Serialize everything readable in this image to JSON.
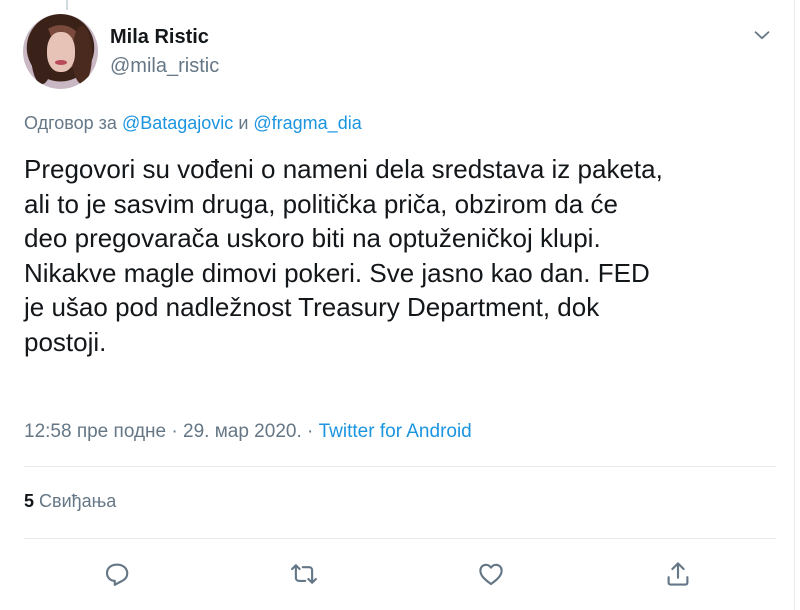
{
  "author": {
    "name": "Mila Ristic",
    "handle": "@mila_ristic"
  },
  "reply_context": {
    "prefix": "Одговор за",
    "mention1": "@Batagajovic",
    "conjunction": "и",
    "mention2": "@fragma_dia"
  },
  "tweet": {
    "text": "Pregovori su vođeni o nameni dela sredstava iz paketa,\nali to je sasvim druga, politička priča, obzirom da će\ndeo pregovarača uskoro biti na optuženičkoj klupi.\nNikakve magle dimovi pokeri. Sve jasno kao dan. FED\nje ušao pod nadležnost Treasury Department, dok\npostoji."
  },
  "meta": {
    "time": "12:58 пре подне",
    "date": "29. мар 2020.",
    "separator": "·",
    "source": "Twitter for Android"
  },
  "stats": {
    "likes_count": "5",
    "likes_label": "Свиђања"
  },
  "icons": {
    "menu": "chevron-down-icon",
    "reply": "reply-icon",
    "retweet": "retweet-icon",
    "like": "heart-icon",
    "share": "share-icon"
  },
  "colors": {
    "link": "#1b95e0",
    "secondary_text": "#657786",
    "primary_text": "#14171a",
    "divider": "#e6ecf0"
  }
}
